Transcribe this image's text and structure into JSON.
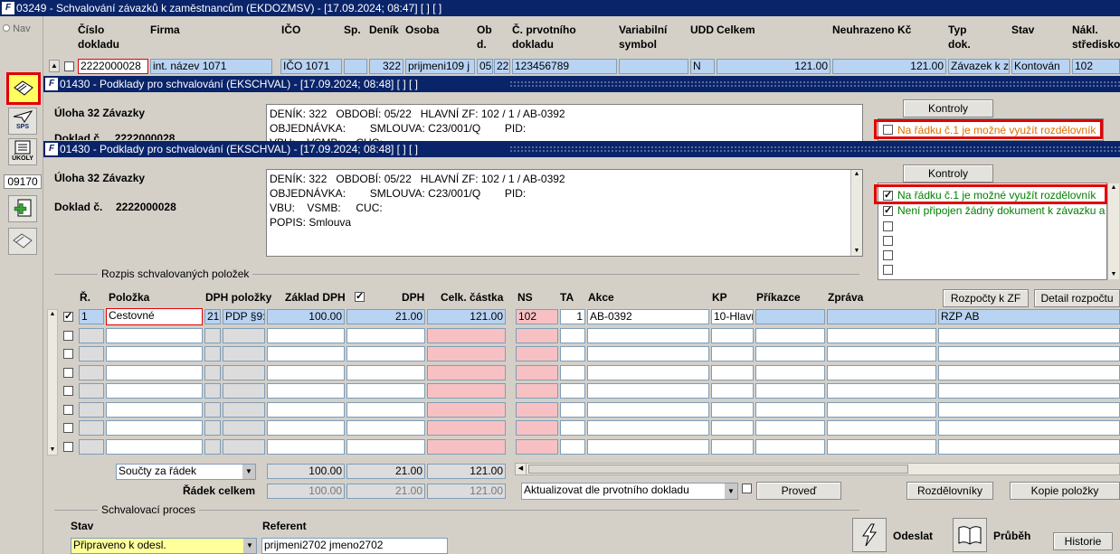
{
  "main_title": "03249 - Schvalování závazků k zaměstnancům (EKDOZMSV) - [17.09.2024; 08:47]  [ ]  [ ]",
  "nav_label": "Nav",
  "sidebar_code": "09170",
  "sps_label": "SPS",
  "ukoly_label": "ÚKOLY",
  "main_headers": {
    "cislo": "Číslo\ndokladu",
    "firma": "Firma",
    "ico": "IČO",
    "sp": "Sp.",
    "denik": "Deník",
    "osoba": "Osoba",
    "obd": "Ob\nd.",
    "prvotni": "Č. prvotního\ndokladu",
    "vs": "Variabilní\nsymbol",
    "udd": "UDD",
    "celkem": "Celkem",
    "neuhr": "Neuhrazeno Kč",
    "typ": "Typ\ndok.",
    "stav": "Stav",
    "nakl": "Nákl.\nstředisko"
  },
  "main_row": {
    "cislo": "2222000028",
    "firma": "int. název 1071",
    "ico": "IČO 1071",
    "denik": "322",
    "osoba": "prijmeni109 j",
    "obd1": "05",
    "obd2": "22",
    "prvotni": "123456789",
    "udd": "N",
    "celkem": "121.00",
    "neuhr": "121.00",
    "typ": "Závazek k zá",
    "stav": "Kontován",
    "nakl": "102"
  },
  "sub_title": "01430 - Podklady pro schvalování (EKSCHVAL) - [17.09.2024; 08:48]  [ ]  [ ]",
  "uloha": "Úloha 32 Závazky",
  "doklad_label": "Doklad č.",
  "doklad_value": "2222000028",
  "back_doklad_label": "Doklad č.",
  "back_doklad_value": "2222000028",
  "info_back": "DENÍK: 322   OBDOBÍ: 05/22   HLAVNÍ ZF: 102 / 1 / AB-0392\nOBJEDNÁVKA:        SMLOUVA: C23/001/Q        PID:\nVBU:    VSMB:     CUC:",
  "info": "DENÍK: 322   OBDOBÍ: 05/22   HLAVNÍ ZF: 102 / 1 / AB-0392\nOBJEDNÁVKA:        SMLOUVA: C23/001/Q        PID:\nVBU:    VSMB:     CUC:\nPOPIS: Smlouva",
  "kontroly_label": "Kontroly",
  "kontrola_back": "Na řádku č.1 je možné využít rozdělovník",
  "kontroly": [
    "Na řádku č.1 je možné využít rozdělovník",
    "Není připojen žádný dokument k závazku a"
  ],
  "rozpis_label": "Rozpis schvalovaných položek",
  "grid_headers": {
    "r": "Ř.",
    "polozka": "Položka",
    "dph_pol": "DPH položky",
    "zaklad": "Základ DPH",
    "dph": "DPH",
    "celk": "Celk. částka",
    "ns": "NS",
    "ta": "TA",
    "akce": "Akce",
    "kp": "KP",
    "prikazce": "Příkazce",
    "zprava": "Zpráva"
  },
  "rozpocty_btn": "Rozpočty k ZF",
  "detail_btn": "Detail rozpočtu",
  "grid_row": {
    "r": "1",
    "polozka": "Cestovné",
    "dph1": "21",
    "dph2": "PDP §9:",
    "zaklad": "100.00",
    "dph": "21.00",
    "celk": "121.00",
    "ns": "102",
    "ta": "1",
    "akce": "AB-0392",
    "kp": "10-Hlavr",
    "rzp": "RZP AB"
  },
  "soucty_select": "Součty za řádek",
  "soucty": {
    "zaklad": "100.00",
    "dph": "21.00",
    "celk": "121.00"
  },
  "radek_celkem_label": "Řádek celkem",
  "radek_celkem": {
    "zaklad": "100.00",
    "dph": "21.00",
    "celk": "121.00"
  },
  "aktualizovat_select": "Aktualizovat dle prvotního dokladu",
  "proved_btn": "Proveď",
  "rozdelovniky_btn": "Rozdělovníky",
  "kopie_btn": "Kopie položky",
  "schval_label": "Schvalovací proces",
  "stav_label": "Stav",
  "stav_value": "Připraveno k odesl.",
  "referent_label": "Referent",
  "referent_value": "prijmeni2702 jmeno2702",
  "odeslat_label": "Odeslat",
  "prubeh_label": "Průběh",
  "historie_btn": "Historie",
  "colors": {
    "title_bg": "#0a246a",
    "highlight": "#e00000",
    "field_blue": "#b9d3f3",
    "field_pink": "#f7c1c3",
    "warn_text": "#e07000",
    "ok_text": "#008000"
  }
}
